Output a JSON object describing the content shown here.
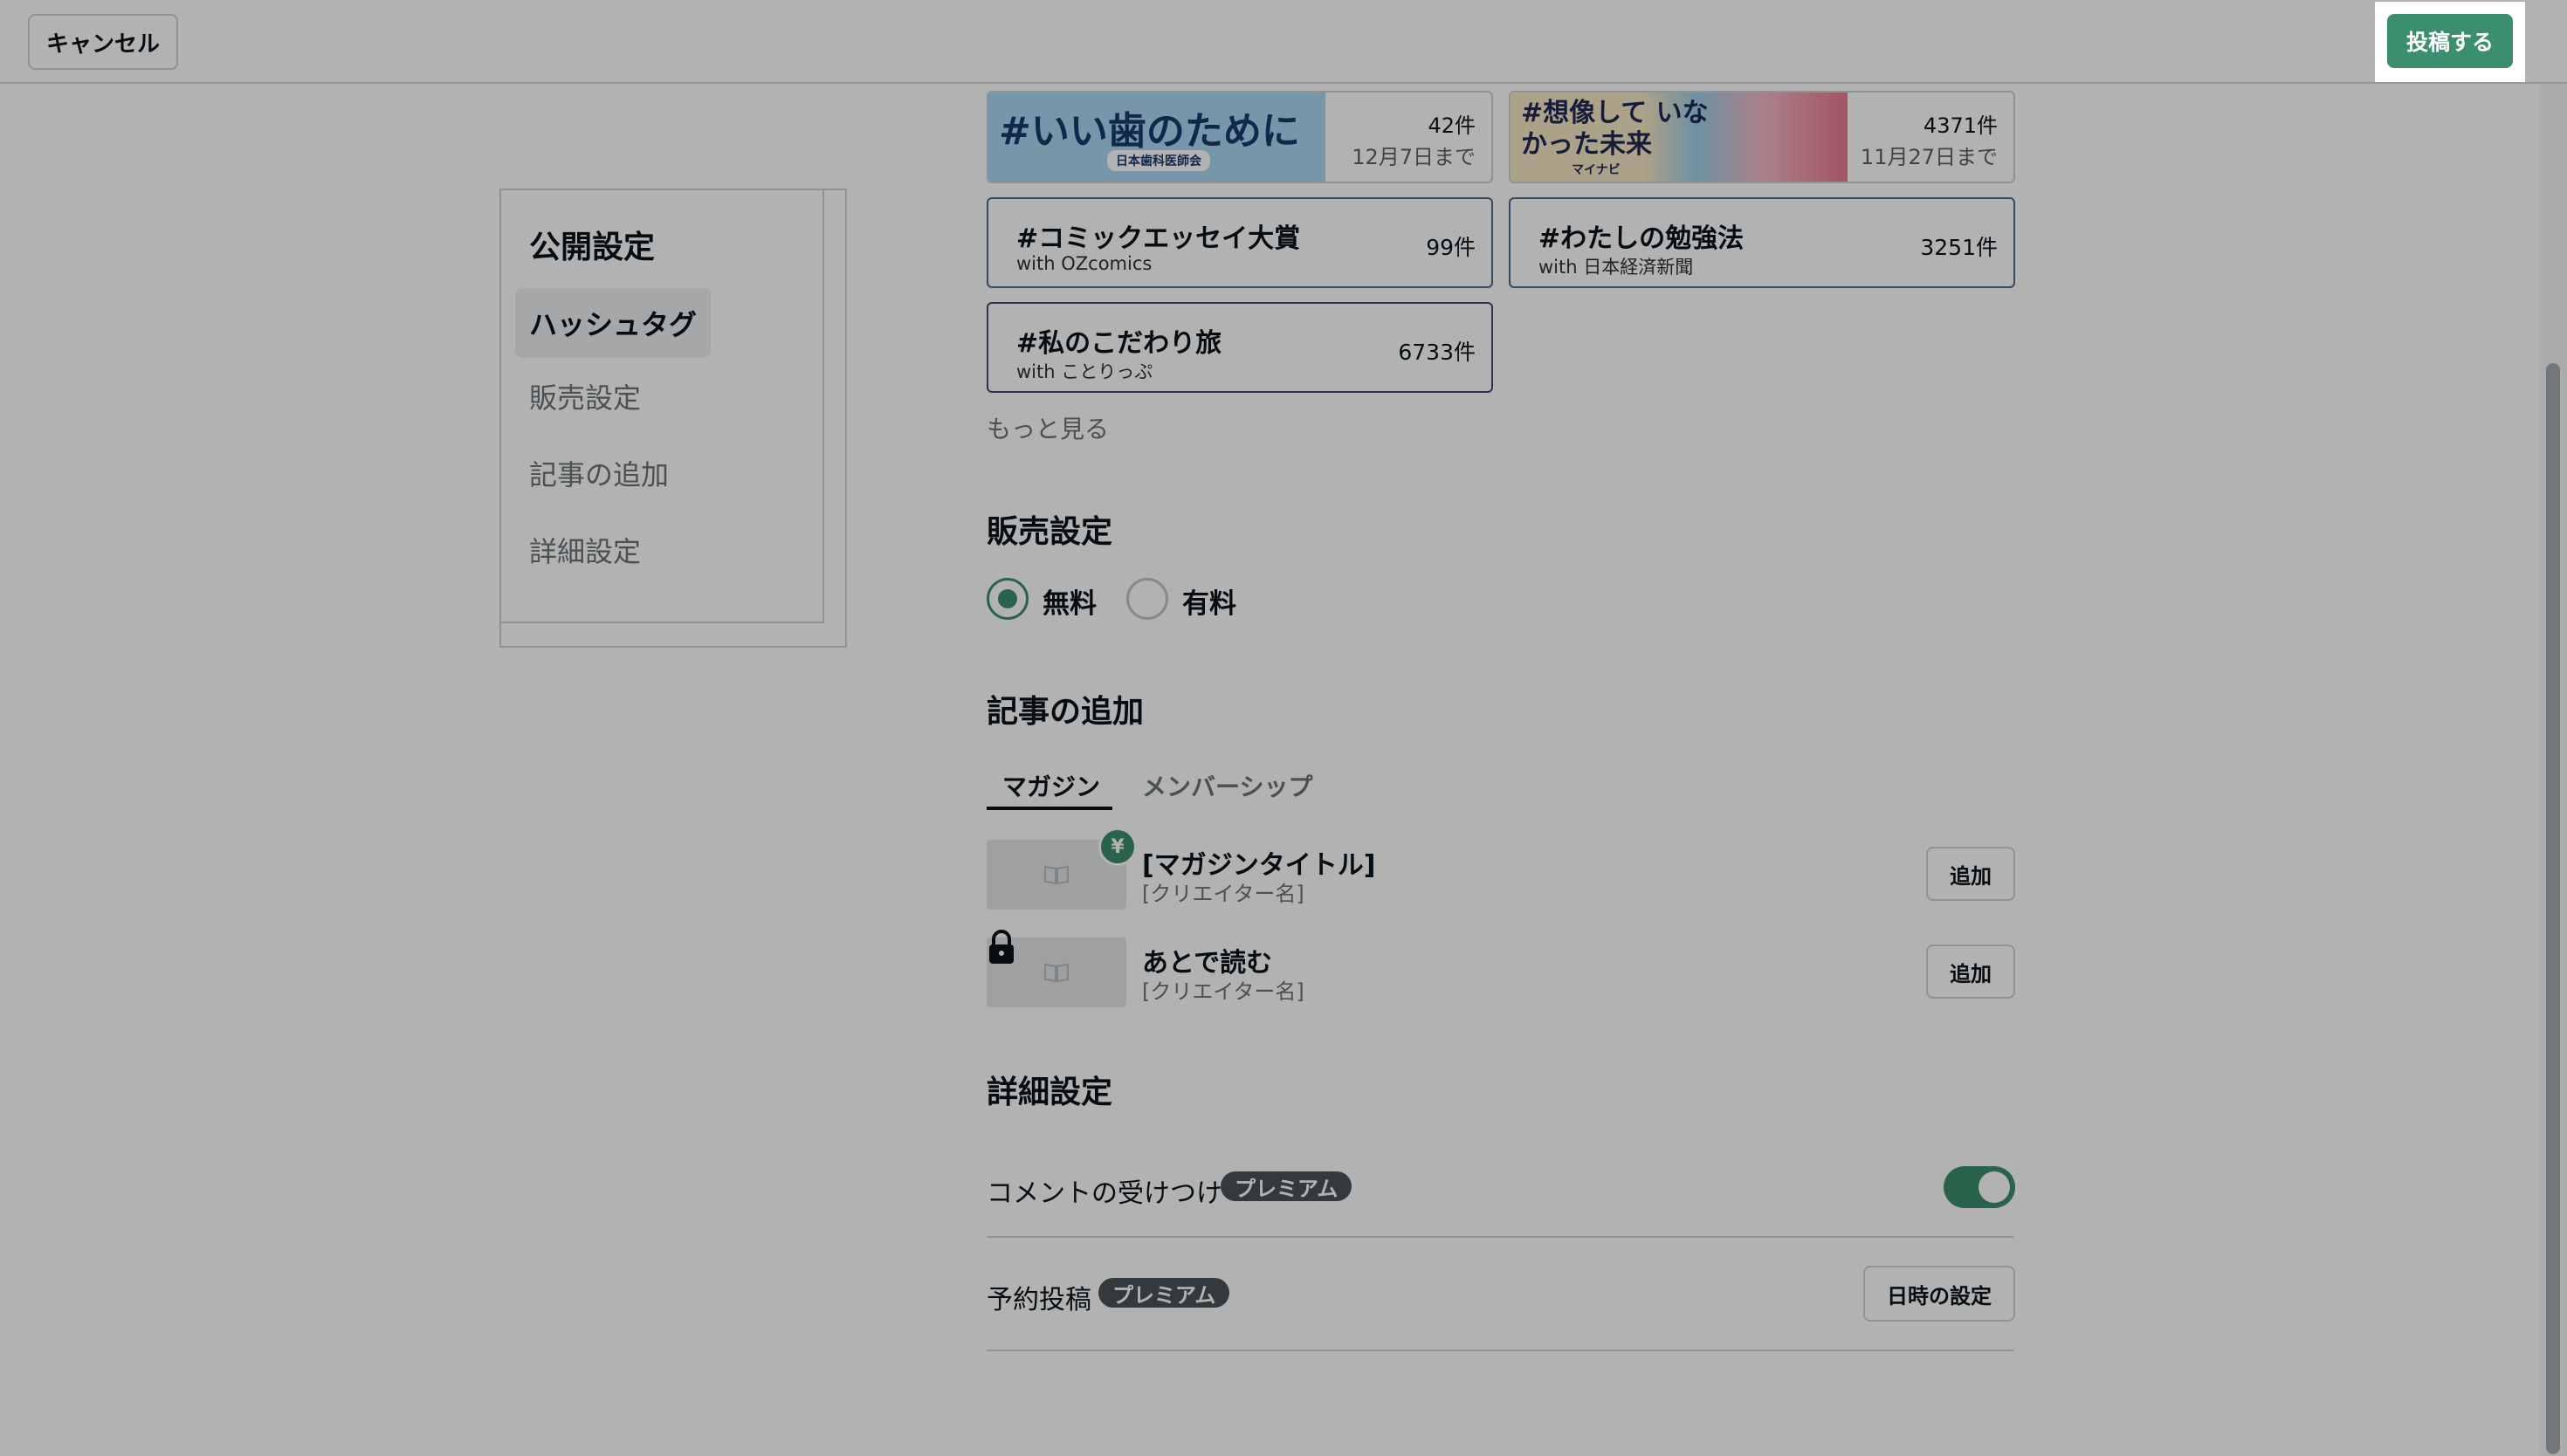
{
  "topbar": {
    "cancel_label": "キャンセル",
    "post_label": "投稿する"
  },
  "leftnav": {
    "title": "公開設定",
    "items": [
      {
        "label": "ハッシュタグ",
        "active": true
      },
      {
        "label": "販売設定",
        "active": false
      },
      {
        "label": "記事の追加",
        "active": false
      },
      {
        "label": "詳細設定",
        "active": false
      }
    ]
  },
  "hashtags": {
    "contests": [
      {
        "banner_text": "#いい歯のために",
        "banner_sub": "日本歯科医師会",
        "count": "42件",
        "deadline": "12月7日まで"
      },
      {
        "banner_text": "#想像して いなかった未来",
        "banner_sub": "マイナビ",
        "count": "4371件",
        "deadline": "11月27日まで"
      }
    ],
    "cards": [
      {
        "hashtag": "#コミックエッセイ大賞",
        "sponsor": "with OZcomics",
        "count": "99件"
      },
      {
        "hashtag": "#わたしの勉強法",
        "sponsor": "with 日本経済新聞",
        "count": "3251件"
      },
      {
        "hashtag": "#私のこだわり旅",
        "sponsor": "with ことりっぷ",
        "count": "6733件"
      }
    ],
    "more_label": "もっと見る"
  },
  "sales": {
    "title": "販売設定",
    "options": [
      {
        "label": "無料",
        "checked": true
      },
      {
        "label": "有料",
        "checked": false
      }
    ]
  },
  "add_article": {
    "title": "記事の追加",
    "tabs": [
      {
        "label": "マガジン",
        "active": true
      },
      {
        "label": "メンバーシップ",
        "active": false
      }
    ],
    "magazines": [
      {
        "title": "[マガジンタイトル]",
        "creator": "[クリエイター名]",
        "badge": "¥",
        "add_label": "追加"
      },
      {
        "title": "あとで読む",
        "creator": "[クリエイター名]",
        "add_label": "追加"
      }
    ]
  },
  "details": {
    "title": "詳細設定",
    "comments_label": "コメントの受けつけ",
    "schedule_label": "予約投稿",
    "premium_label": "プレミアム",
    "date_button_label": "日時の設定",
    "comments_enabled": true
  },
  "colors": {
    "accent": "#3c8f6e",
    "premium_badge": "#4a5256",
    "overlay": "rgba(0,0,0,0.3)"
  }
}
